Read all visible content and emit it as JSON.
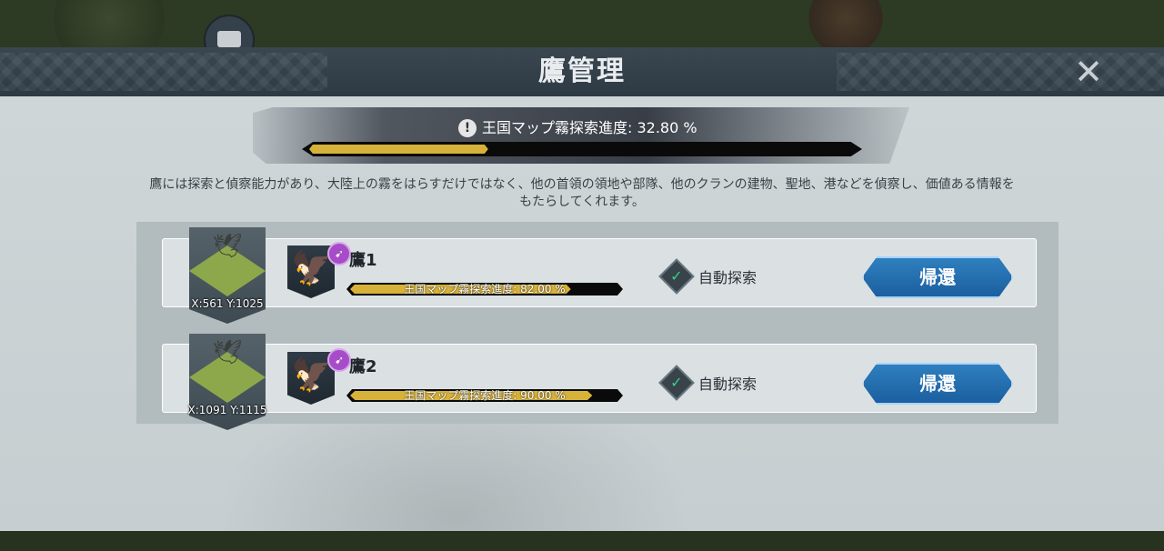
{
  "window": {
    "title": "鷹管理"
  },
  "progress": {
    "label": "王国マップ霧探索進度: 32.80 %",
    "value": 32.8
  },
  "description": "鷹には探索と偵察能力があり、大陸上の霧をはらすだけではなく、他の首領の領地や部隊、他のクランの建物、聖地、港などを偵察し、価値ある情報をもたらしてくれます。",
  "hawks": [
    {
      "name": "鷹1",
      "coords": "X:561 Y:1025",
      "progress_label": "王国マップ霧探索進度: 82.00 %",
      "progress_value": 82.0,
      "auto_label": "自動探索",
      "auto_enabled": true,
      "button_label": "帰還"
    },
    {
      "name": "鷹2",
      "coords": "X:1091 Y:1115",
      "progress_label": "王国マップ霧探索進度: 90.00 %",
      "progress_value": 90.0,
      "auto_label": "自動探索",
      "auto_enabled": true,
      "button_label": "帰還"
    }
  ],
  "icons": {
    "close": "close-icon",
    "info": "info-icon",
    "check": "check-icon",
    "bird": "bird-icon",
    "eagle": "eagle-portrait-icon",
    "badge": "level-badge-icon"
  },
  "colors": {
    "header_bg": "#3a4750",
    "panel_bg": "#cfd6d8",
    "bar_fill": "#d7b23a",
    "button_bg": "#1b5f9f",
    "check": "#36d28a"
  }
}
